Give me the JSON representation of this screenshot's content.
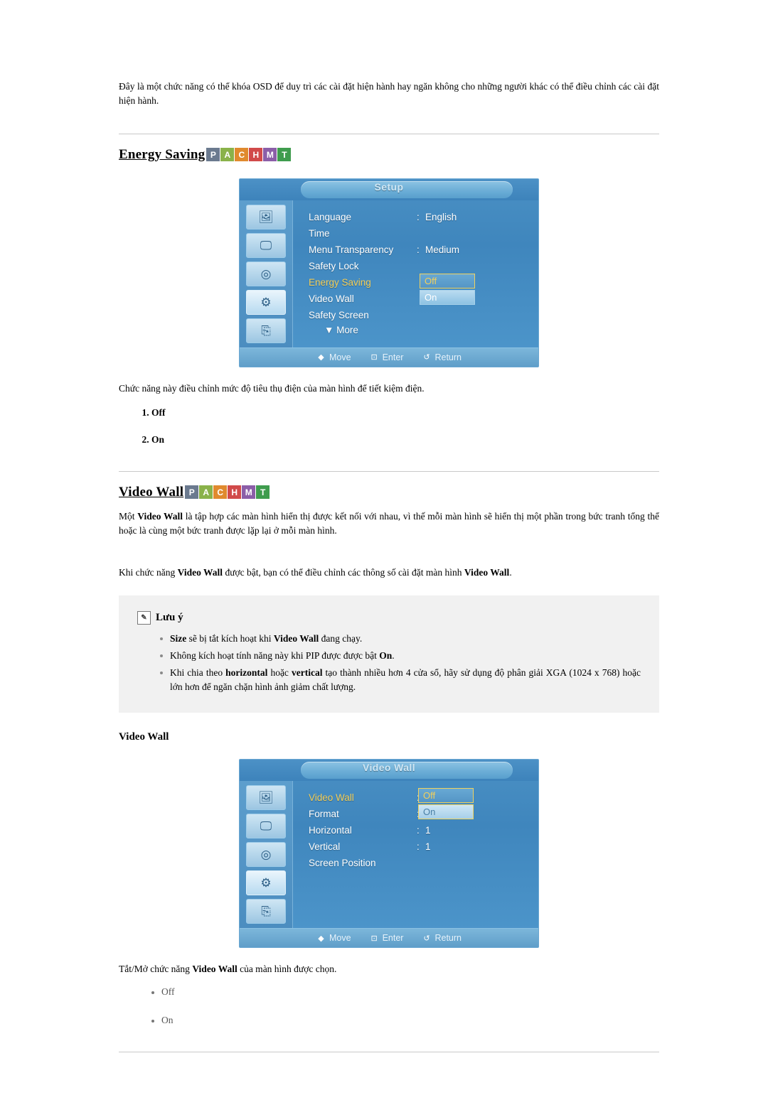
{
  "intro_paragraph": "Đây là một chức năng có thể khóa OSD để duy trì các cài đặt hiện hành hay ngăn không cho những người khác có thể điều chỉnh các cài đặt hiện hành.",
  "badge": {
    "letters": [
      "P",
      "A",
      "C",
      "H",
      "M",
      "T"
    ],
    "colors": [
      "#6b7a8f",
      "#8ab24a",
      "#e08a2e",
      "#d14a4a",
      "#8b5ea8",
      "#3f9c4e"
    ]
  },
  "section_energy": {
    "title": "Energy Saving",
    "description": "Chức năng này điều chỉnh mức độ tiêu thụ điện của màn hình để tiết kiệm điện.",
    "options": [
      "Off",
      "On"
    ],
    "osd": {
      "title": "Setup",
      "rows": [
        {
          "label": "Language",
          "colon": ":",
          "value": "English",
          "active": false
        },
        {
          "label": "Time",
          "colon": "",
          "value": "",
          "active": false
        },
        {
          "label": "Menu Transparency",
          "colon": ":",
          "value": "Medium",
          "active": false
        },
        {
          "label": "Safety Lock",
          "colon": "",
          "value": "",
          "active": false
        },
        {
          "label": "Energy Saving",
          "colon": "",
          "value": "",
          "active": true
        },
        {
          "label": "Video Wall",
          "colon": "",
          "value": "",
          "active": false
        },
        {
          "label": "Safety Screen",
          "colon": "",
          "value": "",
          "active": false
        }
      ],
      "more_label": "▼ More",
      "popup": {
        "off": "Off",
        "on": "On"
      },
      "footer": [
        {
          "glyph": "◆",
          "label": "Move"
        },
        {
          "glyph": "⊡",
          "label": "Enter"
        },
        {
          "glyph": "↺",
          "label": "Return"
        }
      ]
    }
  },
  "section_videowall": {
    "title": "Video Wall",
    "paragraph1_pre": "Một ",
    "paragraph1_bold": "Video Wall",
    "paragraph1_post": " là tập hợp các màn hình hiển thị được kết nối với nhau, vì thế mỗi màn hình sẽ hiển thị một phần trong bức tranh tổng thể hoặc là cùng một bức tranh được lặp lại ở mỗi màn hình.",
    "paragraph2_pre": "Khi chức năng ",
    "paragraph2_b1": "Video Wall",
    "paragraph2_mid": " được bật, bạn có thể điều chỉnh các thông số cài đặt màn hình ",
    "paragraph2_b2": "Video Wall",
    "paragraph2_post": ".",
    "note": {
      "title": "Lưu ý",
      "items": [
        {
          "pre": "",
          "b1": "Size",
          "mid": " sẽ bị tắt kích hoạt khi ",
          "b2": "Video Wall",
          "post": " đang chạy."
        },
        {
          "pre": "Không kích hoạt tính năng này khi PIP được được bật ",
          "b1": "On",
          "mid": "",
          "b2": "",
          "post": "."
        },
        {
          "pre": "Khi chia theo ",
          "b1": "horizontal",
          "mid": " hoặc ",
          "b2": "vertical",
          "post": " tạo thành nhiều hơn 4 cửa sổ, hãy sử dụng độ phân giải XGA (1024 x 768) hoặc lớn hơn để ngăn chặn hình ảnh giảm chất lượng."
        }
      ]
    },
    "subheading": "Video Wall",
    "description_pre": "Tắt/Mở chức năng ",
    "description_bold": "Video Wall",
    "description_post": " của màn hình được chọn.",
    "options": [
      "Off",
      "On"
    ],
    "osd": {
      "title": "Video Wall",
      "rows": [
        {
          "label": "Video Wall",
          "colon": ":",
          "value": "Off",
          "active": true
        },
        {
          "label": "Format",
          "colon": ":",
          "value": "On",
          "active": false
        },
        {
          "label": "Horizontal",
          "colon": ":",
          "value": "1",
          "active": false
        },
        {
          "label": "Vertical",
          "colon": ":",
          "value": "1",
          "active": false
        },
        {
          "label": "Screen Position",
          "colon": "",
          "value": "",
          "active": false
        }
      ],
      "popup": {
        "off": "Off",
        "on": "On"
      },
      "footer": [
        {
          "glyph": "◆",
          "label": "Move"
        },
        {
          "glyph": "⊡",
          "label": "Enter"
        },
        {
          "glyph": "↺",
          "label": "Return"
        }
      ]
    }
  },
  "osd_icons": [
    "🖼",
    "🖵",
    "◎",
    "⚙",
    "⎘"
  ]
}
